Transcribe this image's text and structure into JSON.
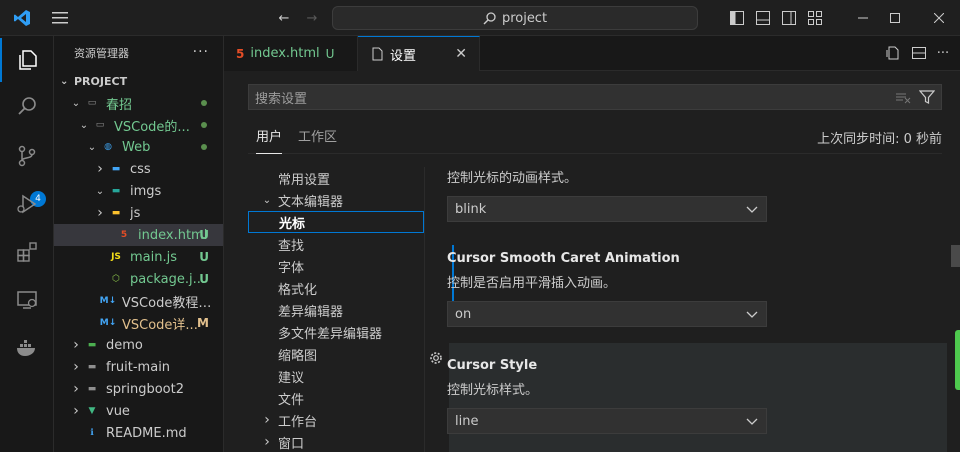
{
  "titlebar": {
    "search_text": "project"
  },
  "activity": {
    "scm_badge": "4"
  },
  "sidebar": {
    "title": "资源管理器",
    "more": "···",
    "project_title": "PROJECT",
    "tree": [
      {
        "label": "春招",
        "indent": 1,
        "chevron": "open",
        "icon": "folder-open-icon",
        "color": "green",
        "status": "dot"
      },
      {
        "label": "VSCode的...",
        "indent": 2,
        "chevron": "open",
        "icon": "folder-open-icon",
        "color": "green",
        "status": "dot"
      },
      {
        "label": "Web",
        "indent": 3,
        "chevron": "open",
        "icon": "web-folder-icon",
        "color": "green",
        "status": "dot"
      },
      {
        "label": "css",
        "indent": 4,
        "chevron": "closed",
        "icon": "css-folder-icon",
        "color": "normal",
        "status": ""
      },
      {
        "label": "imgs",
        "indent": 4,
        "chevron": "open",
        "icon": "images-folder-icon",
        "color": "normal",
        "status": ""
      },
      {
        "label": "js",
        "indent": 4,
        "chevron": "closed",
        "icon": "js-folder-icon",
        "color": "normal",
        "status": ""
      },
      {
        "label": "index.html",
        "indent": 5,
        "chevron": "none",
        "icon": "html-file-icon",
        "color": "green",
        "status": "U",
        "selected": true
      },
      {
        "label": "main.js",
        "indent": 4,
        "chevron": "none",
        "icon": "js-file-icon",
        "color": "green",
        "status": "U"
      },
      {
        "label": "package.j...",
        "indent": 4,
        "chevron": "none",
        "icon": "npm-file-icon",
        "color": "green",
        "status": "U"
      },
      {
        "label": "VSCode教程够...",
        "indent": 3,
        "chevron": "none",
        "icon": "markdown-file-icon",
        "color": "normal",
        "status": ""
      },
      {
        "label": "VSCode详...",
        "indent": 3,
        "chevron": "none",
        "icon": "markdown-file-icon",
        "color": "yellow",
        "status": "M"
      },
      {
        "label": "demo",
        "indent": 1,
        "chevron": "closed",
        "icon": "folder-src-icon",
        "color": "normal",
        "status": ""
      },
      {
        "label": "fruit-main",
        "indent": 1,
        "chevron": "closed",
        "icon": "folder-icon",
        "color": "normal",
        "status": ""
      },
      {
        "label": "springboot2",
        "indent": 1,
        "chevron": "closed",
        "icon": "folder-icon",
        "color": "normal",
        "status": ""
      },
      {
        "label": "vue",
        "indent": 1,
        "chevron": "closed",
        "icon": "vue-folder-icon",
        "color": "normal",
        "status": ""
      },
      {
        "label": "README.md",
        "indent": 1,
        "chevron": "none",
        "icon": "info-file-icon",
        "color": "normal",
        "status": ""
      }
    ]
  },
  "tabs": {
    "index": {
      "label": "index.html",
      "status": "U"
    },
    "settings": {
      "label": "设置",
      "close": "✕"
    }
  },
  "settings": {
    "search_placeholder": "搜索设置",
    "scope_user": "用户",
    "scope_workspace": "工作区",
    "sync_text": "上次同步时间: 0 秒前",
    "toc": [
      {
        "label": "常用设置",
        "indent": 1,
        "chevron": "none"
      },
      {
        "label": "文本编辑器",
        "indent": 0,
        "chevron": "open"
      },
      {
        "label": "光标",
        "indent": 1,
        "chevron": "none",
        "active": true
      },
      {
        "label": "查找",
        "indent": 1,
        "chevron": "none"
      },
      {
        "label": "字体",
        "indent": 1,
        "chevron": "none"
      },
      {
        "label": "格式化",
        "indent": 1,
        "chevron": "none"
      },
      {
        "label": "差异编辑器",
        "indent": 1,
        "chevron": "none"
      },
      {
        "label": "多文件差异编辑器",
        "indent": 1,
        "chevron": "none"
      },
      {
        "label": "缩略图",
        "indent": 1,
        "chevron": "none"
      },
      {
        "label": "建议",
        "indent": 1,
        "chevron": "none"
      },
      {
        "label": "文件",
        "indent": 1,
        "chevron": "none"
      },
      {
        "label": "工作台",
        "indent": 0,
        "chevron": "closed"
      },
      {
        "label": "窗口",
        "indent": 0,
        "chevron": "closed"
      }
    ],
    "items": {
      "blinking": {
        "desc": "控制光标的动画样式。",
        "value": "blink"
      },
      "smooth": {
        "title": "Cursor Smooth Caret Animation",
        "desc": "控制是否启用平滑插入动画。",
        "value": "on"
      },
      "style": {
        "title": "Cursor Style",
        "desc": "控制光标样式。",
        "value": "line"
      }
    }
  },
  "colors": {
    "accent": "#0078d4",
    "untracked": "#73c991",
    "modified": "#e2c08d"
  }
}
